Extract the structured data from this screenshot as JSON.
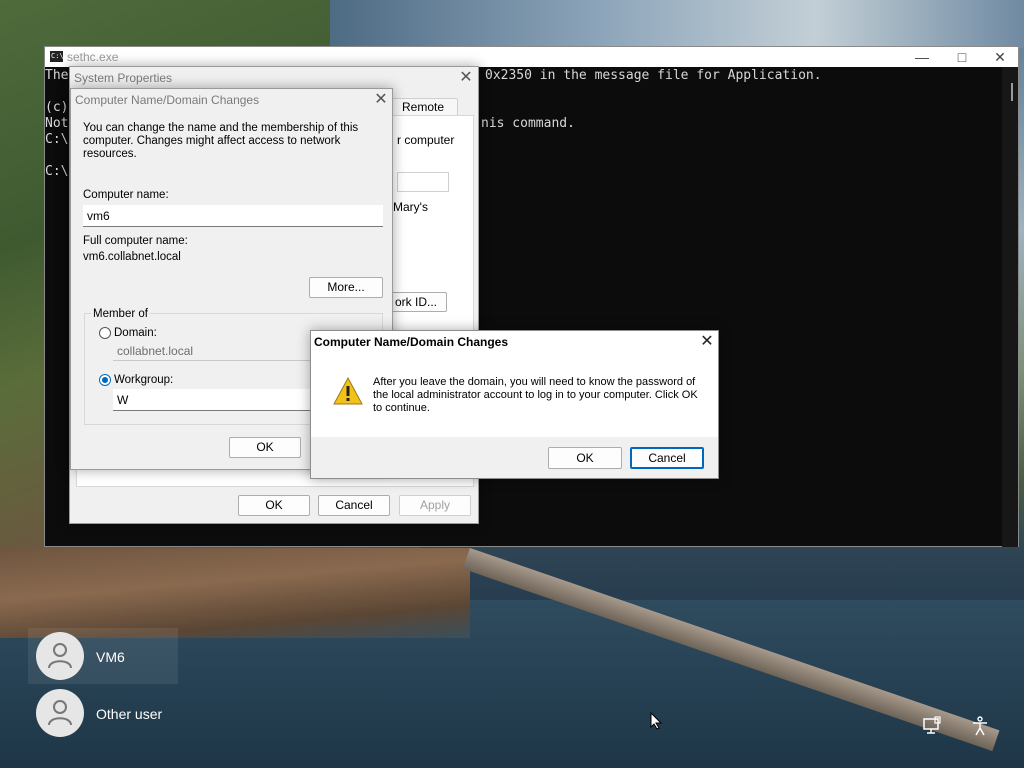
{
  "cmd": {
    "title": "sethc.exe",
    "lines": [
      "The",
      "",
      "(c)",
      "Not",
      "C:\\",
      "",
      "C:\\"
    ],
    "visible_right_line1": "0x2350 in the message file for Application.",
    "visible_right_line2": "nis command."
  },
  "system_properties": {
    "title": "System Properties",
    "tab_remote": "Remote",
    "partial_text1": "r computer",
    "partial_text2": "Mary's",
    "network_id_button": "ork ID...",
    "ok": "OK",
    "cancel": "Cancel",
    "apply": "Apply"
  },
  "domain_changes": {
    "title": "Computer Name/Domain Changes",
    "description_line1": "You can change the name and the membership of this",
    "description_line2": "computer. Changes might affect access to network resources.",
    "computer_name_label": "Computer name:",
    "computer_name_value": "vm6",
    "full_name_label": "Full computer name:",
    "full_name_value": "vm6.collabnet.local",
    "more_button": "More...",
    "member_of": "Member of",
    "domain_label": "Domain:",
    "domain_value": "collabnet.local",
    "workgroup_label": "Workgroup:",
    "workgroup_value": "W",
    "ok": "OK"
  },
  "alert": {
    "title": "Computer Name/Domain Changes",
    "message_line1": "After you leave the domain, you will need to know the password of",
    "message_line2": "the local administrator account to log in to your computer. Click OK",
    "message_line3": "to continue.",
    "ok": "OK",
    "cancel": "Cancel"
  },
  "login": {
    "users": [
      {
        "name": "VM6"
      },
      {
        "name": "Other user"
      }
    ]
  }
}
